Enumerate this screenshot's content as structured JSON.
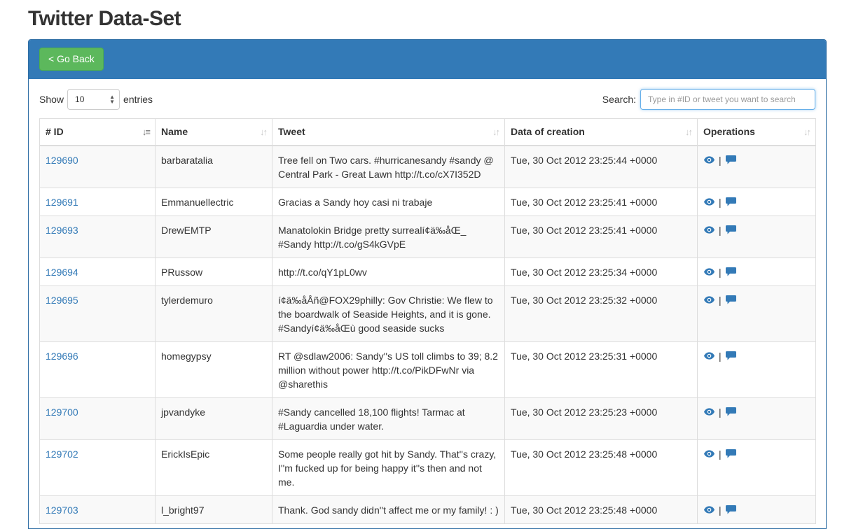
{
  "page": {
    "title": "Twitter Data-Set"
  },
  "toolbar": {
    "back_label": "< Go Back"
  },
  "length": {
    "show_label": "Show",
    "selected": "10",
    "entries_label": "entries"
  },
  "search": {
    "label": "Search:",
    "placeholder": "Type in #ID or tweet you want to search",
    "value": ""
  },
  "table": {
    "columns": [
      "# ID",
      "Name",
      "Tweet",
      "Data of creation",
      "Operations"
    ],
    "rows": [
      {
        "id": "129690",
        "name": "barbaratalia",
        "tweet": "Tree fell on Two cars. #hurricanesandy #sandy @ Central Park - Great Lawn http://t.co/cX7I352D",
        "date": "Tue, 30 Oct 2012 23:25:44 +0000"
      },
      {
        "id": "129691",
        "name": "Emmanuellectric",
        "tweet": "Gracias a Sandy hoy casi ni trabaje",
        "date": "Tue, 30 Oct 2012 23:25:41 +0000"
      },
      {
        "id": "129693",
        "name": "DrewEMTP",
        "tweet": "Manatolokin Bridge pretty surrealí¢ä‰åŒ_ #Sandy http://t.co/gS4kGVpE",
        "date": "Tue, 30 Oct 2012 23:25:41 +0000"
      },
      {
        "id": "129694",
        "name": "PRussow",
        "tweet": "http://t.co/qY1pL0wv",
        "date": "Tue, 30 Oct 2012 23:25:34 +0000"
      },
      {
        "id": "129695",
        "name": "tylerdemuro",
        "tweet": "í¢ä‰åÅñ@FOX29philly: Gov Christie: We flew to the boardwalk of Seaside Heights, and it is gone. #Sandyí¢ä‰åŒù good seaside sucks",
        "date": "Tue, 30 Oct 2012 23:25:32 +0000"
      },
      {
        "id": "129696",
        "name": "homegypsy",
        "tweet": "RT @sdlaw2006: Sandy''s US toll climbs to 39; 8.2 million without power http://t.co/PikDFwNr via @sharethis",
        "date": "Tue, 30 Oct 2012 23:25:31 +0000"
      },
      {
        "id": "129700",
        "name": "jpvandyke",
        "tweet": "#Sandy cancelled 18,100 flights! Tarmac at #Laguardia under water.",
        "date": "Tue, 30 Oct 2012 23:25:23 +0000"
      },
      {
        "id": "129702",
        "name": "ErickIsEpic",
        "tweet": "Some people really got hit by Sandy. That''s crazy, I''m fucked up for being happy it''s then and not me.",
        "date": "Tue, 30 Oct 2012 23:25:48 +0000"
      },
      {
        "id": "129703",
        "name": "l_bright97",
        "tweet": "Thank. God sandy didn''t affect me or my family! : )",
        "date": "Tue, 30 Oct 2012 23:25:48 +0000"
      }
    ],
    "ops_separator": "|"
  },
  "icons": {
    "view": "eye-icon",
    "comment": "comment-icon",
    "accent": "#337ab7"
  }
}
